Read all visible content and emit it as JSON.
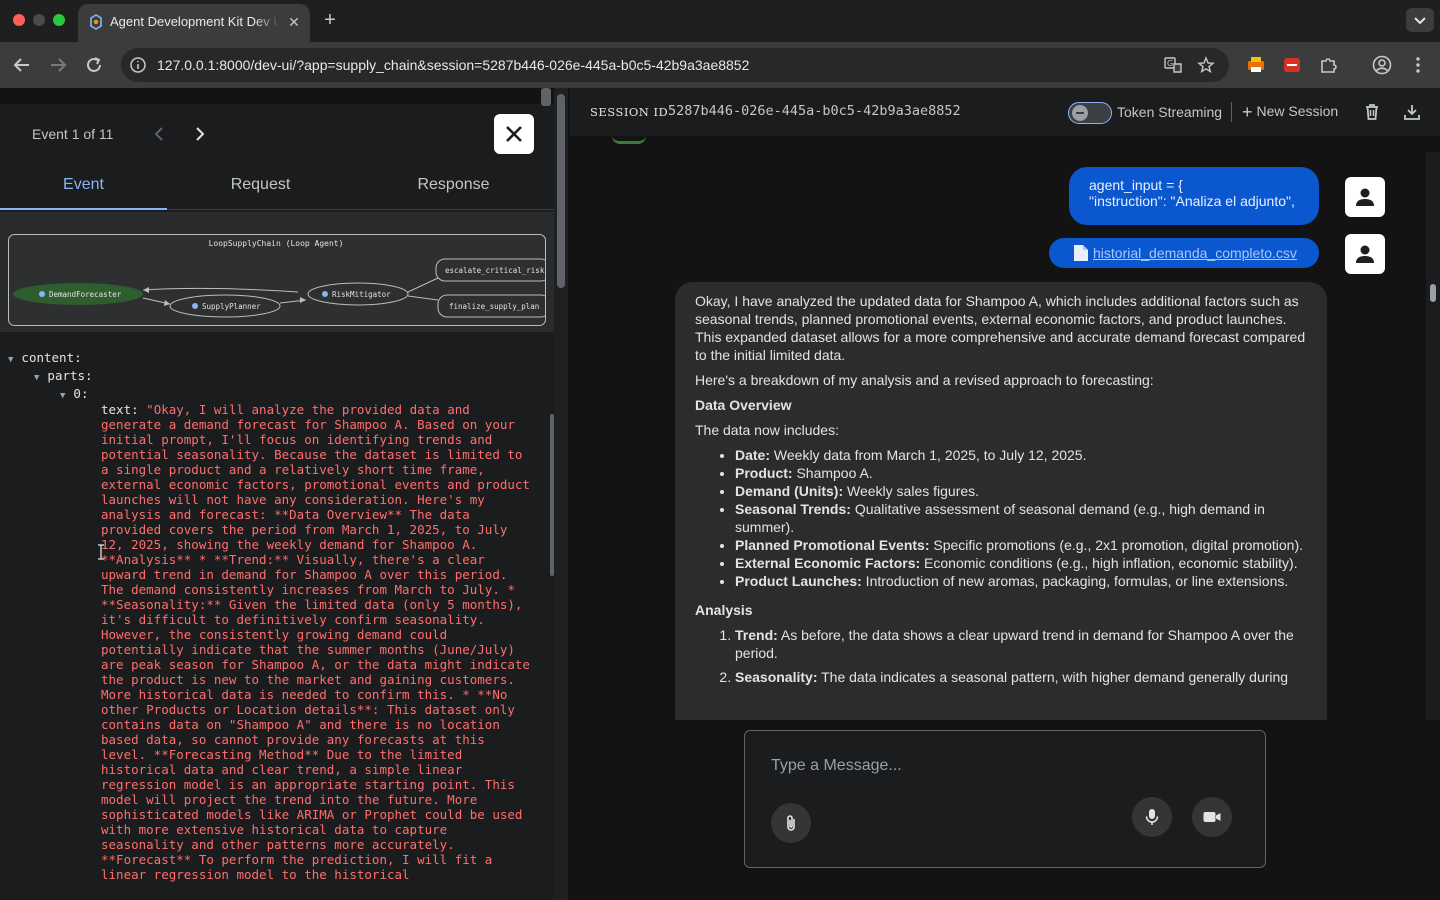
{
  "browser": {
    "tab_title": "Agent Development Kit Dev UI",
    "url": "127.0.0.1:8000/dev-ui/?app=supply_chain&session=5287b446-026e-445a-b0c5-42b9a3ae8852"
  },
  "event_panel": {
    "event_counter": "Event 1 of 11",
    "tabs": [
      "Event",
      "Request",
      "Response"
    ],
    "graph": {
      "title": "LoopSupplyChain (Loop Agent)",
      "nodes": {
        "demand": "DemandForecaster",
        "supply": "SupplyPlanner",
        "risk": "RiskMitigator",
        "escalate": "escalate_critical_risk",
        "finalize": "finalize_supply_plan"
      }
    },
    "tree": {
      "content_key": "content:",
      "parts_key": "parts:",
      "index_key": "0:",
      "text_key": "text:",
      "text_value": "\"Okay, I will analyze the provided data and generate a demand forecast for Shampoo A. Based on your initial prompt, I'll focus on identifying trends and potential seasonality. Because the dataset is limited to a single product and a relatively short time frame, external economic factors, promotional events and product launches will not have any consideration. Here's my analysis and forecast: **Data Overview** The data provided covers the period from March 1, 2025, to July 12, 2025, showing the weekly demand for Shampoo A. **Analysis** * **Trend:** Visually, there's a clear upward trend in demand for Shampoo A over this period. The demand consistently increases from March to July. * **Seasonality:** Given the limited data (only 5 months), it's difficult to definitively confirm seasonality. However, the consistently growing demand could potentially indicate that the summer months (June/July) are peak season for Shampoo A, or the data might indicate the product is new to the market and gaining customers. More historical data is needed to confirm this. * **No other Products or Location details**: This dataset only contains data on \"Shampoo A\" and there is no location based data, so cannot provide any forecasts at this level. **Forecasting Method** Due to the limited historical data and clear trend, a simple linear regression model is an appropriate starting point. This model will project the trend into the future. More sophisticated models like ARIMA or Prophet could be used with more extensive historical data to capture seasonality and other patterns more accurately. **Forecast** To perform the prediction, I will fit a linear regression model to the historical"
    }
  },
  "session_bar": {
    "label": "SESSION ID",
    "session_id": "5287b446-026e-445a-b0c5-42b9a3ae8852",
    "streaming_label": "Token Streaming",
    "new_session_label": "New Session"
  },
  "chat": {
    "user_message_line1": "agent_input = {",
    "user_message_line2": "\"instruction\": \"Analiza el adjunto\",",
    "attachment_name": "historial_demanda_completo.csv",
    "bot": {
      "intro": "Okay, I have analyzed the updated data for Shampoo A, which includes additional factors such as seasonal trends, planned promotional events, external economic factors, and product launches. This expanded dataset allows for a more comprehensive and accurate demand forecast compared to the initial limited data.",
      "breakdown": "Here's a breakdown of my analysis and a revised approach to forecasting:",
      "overview_heading": "Data Overview",
      "overview_lead": "The data now includes:",
      "bullets": [
        {
          "k": "Date:",
          "v": " Weekly data from March 1, 2025, to July 12, 2025."
        },
        {
          "k": "Product:",
          "v": " Shampoo A."
        },
        {
          "k": "Demand (Units):",
          "v": " Weekly sales figures."
        },
        {
          "k": "Seasonal Trends:",
          "v": " Qualitative assessment of seasonal demand (e.g., high demand in summer)."
        },
        {
          "k": "Planned Promotional Events:",
          "v": " Specific promotions (e.g., 2x1 promotion, digital promotion)."
        },
        {
          "k": "External Economic Factors:",
          "v": " Economic conditions (e.g., high inflation, economic stability)."
        },
        {
          "k": "Product Launches:",
          "v": " Introduction of new aromas, packaging, formulas, or line extensions."
        }
      ],
      "analysis_heading": "Analysis",
      "analysis_items": [
        {
          "k": "Trend:",
          "v": " As before, the data shows a clear upward trend in demand for Shampoo A over the period."
        },
        {
          "k": "Seasonality:",
          "v": " The data indicates a seasonal pattern, with higher demand generally during"
        }
      ]
    }
  },
  "composer": {
    "placeholder": "Type a Message..."
  },
  "colors": {
    "accent": "#8ab4f8",
    "user_bubble": "#0b57d0",
    "json_string": "#ff6e6e",
    "graph_active_node": "#2e5e2e"
  }
}
